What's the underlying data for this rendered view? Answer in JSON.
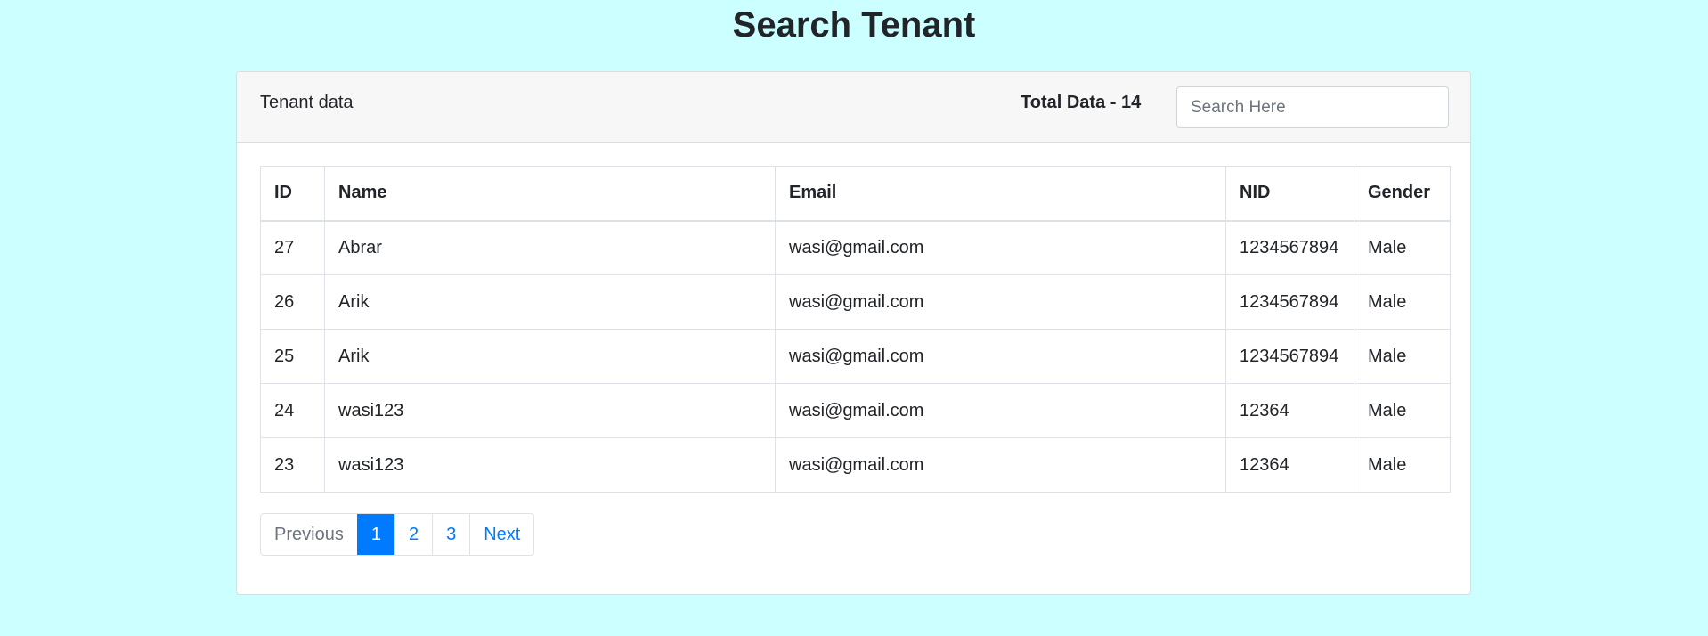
{
  "page": {
    "title": "Search Tenant"
  },
  "header": {
    "label": "Tenant data",
    "total_label": "Total Data - 14",
    "search_placeholder": "Search Here"
  },
  "table": {
    "columns": [
      "ID",
      "Name",
      "Email",
      "NID",
      "Gender"
    ],
    "rows": [
      [
        "27",
        "Abrar",
        "wasi@gmail.com",
        "1234567894",
        "Male"
      ],
      [
        "26",
        "Arik",
        "wasi@gmail.com",
        "1234567894",
        "Male"
      ],
      [
        "25",
        "Arik",
        "wasi@gmail.com",
        "1234567894",
        "Male"
      ],
      [
        "24",
        "wasi123",
        "wasi@gmail.com",
        "12364",
        "Male"
      ],
      [
        "23",
        "wasi123",
        "wasi@gmail.com",
        "12364",
        "Male"
      ]
    ]
  },
  "pagination": {
    "previous": "Previous",
    "pages": [
      "1",
      "2",
      "3"
    ],
    "active_page": "1",
    "next": "Next"
  },
  "colors": {
    "background": "#ccffff",
    "accent": "#007bff"
  }
}
